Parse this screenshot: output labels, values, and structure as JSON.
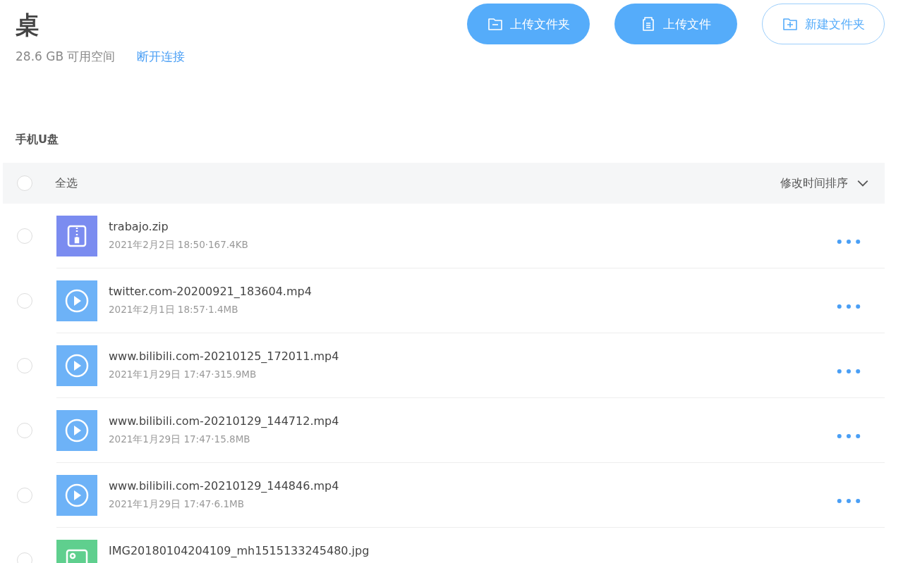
{
  "header": {
    "title": "桌",
    "free_space": "28.6 GB 可用空间",
    "disconnect_link": "断开连接"
  },
  "actions": [
    {
      "kind": "upload-folder",
      "label": "上传文件夹",
      "primary": true
    },
    {
      "kind": "upload-file",
      "label": "上传文件",
      "primary": true
    },
    {
      "kind": "new-folder",
      "label": "新建文件夹",
      "primary": false
    }
  ],
  "section_title": "手机U盘",
  "list_header": {
    "select_all": "全选",
    "select_all_checked": false,
    "sort": "修改时间排序"
  },
  "files": [
    {
      "kind": "zip",
      "name": "trabajo.zip",
      "meta": "2021年2月2日 18:50·167.4KB",
      "selected": false
    },
    {
      "kind": "video",
      "name": "twitter.com-20200921_183604.mp4",
      "meta": "2021年2月1日 18:57·1.4MB",
      "selected": false
    },
    {
      "kind": "video",
      "name": "www.bilibili.com-20210125_172011.mp4",
      "meta": "2021年1月29日 17:47·315.9MB",
      "selected": false
    },
    {
      "kind": "video",
      "name": "www.bilibili.com-20210129_144712.mp4",
      "meta": "2021年1月29日 17:47·15.8MB",
      "selected": false
    },
    {
      "kind": "video",
      "name": "www.bilibili.com-20210129_144846.mp4",
      "meta": "2021年1月29日 17:47·6.1MB",
      "selected": false
    },
    {
      "kind": "image",
      "name": "IMG20180104204109_mh1515133245480.jpg",
      "selected": false
    }
  ]
}
